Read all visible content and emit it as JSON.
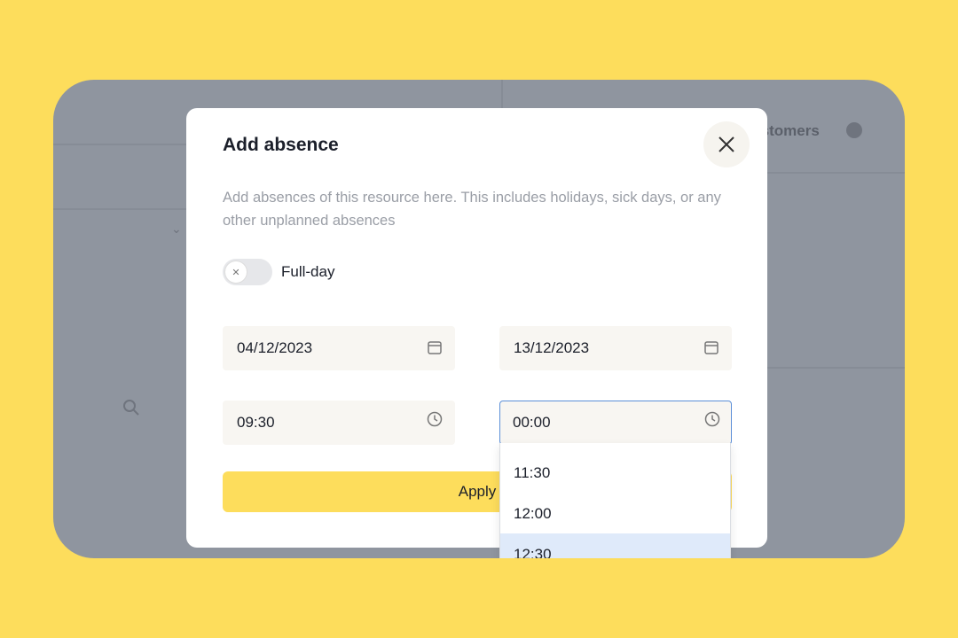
{
  "background": {
    "column_label": "Customers"
  },
  "modal": {
    "title": "Add absence",
    "description": "Add absences of this resource here. This includes holidays, sick days, or any other unplanned absences",
    "full_day": {
      "label": "Full-day",
      "checked": false
    },
    "start_date": "04/12/2023",
    "end_date": "13/12/2023",
    "start_time": "09:30",
    "end_time": "00:00",
    "apply_label": "Apply",
    "time_options": [
      "11:30",
      "12:00",
      "12:30"
    ],
    "highlighted_option": "12:30"
  },
  "colors": {
    "accent": "#FDDD5C",
    "focus": "#5b8fd8",
    "highlight": "#dfeafa"
  }
}
